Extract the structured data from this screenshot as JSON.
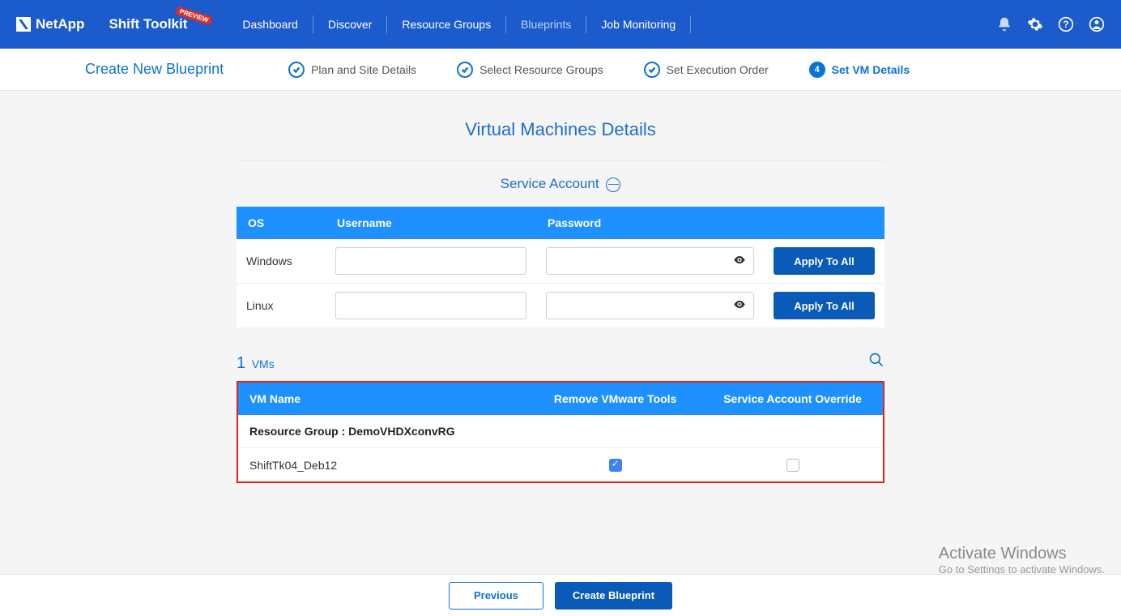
{
  "brand": {
    "company": "NetApp",
    "product": "Shift Toolkit",
    "badge": "PREVIEW"
  },
  "nav": {
    "items": [
      "Dashboard",
      "Discover",
      "Resource Groups",
      "Blueprints",
      "Job Monitoring"
    ],
    "active_index": 3
  },
  "page": {
    "title": "Create New Blueprint",
    "steps": [
      "Plan and Site Details",
      "Select Resource Groups",
      "Set Execution Order",
      "Set VM Details"
    ],
    "active_step": 3,
    "section_title": "Virtual Machines Details",
    "service_account_title": "Service Account",
    "collapse_glyph": "—"
  },
  "service_account": {
    "headers": {
      "os": "OS",
      "username": "Username",
      "password": "Password"
    },
    "rows": [
      {
        "os": "Windows",
        "username": "",
        "password": "",
        "apply_label": "Apply To All"
      },
      {
        "os": "Linux",
        "username": "",
        "password": "",
        "apply_label": "Apply To All"
      }
    ]
  },
  "vms": {
    "count": "1",
    "count_label": "VMs",
    "headers": {
      "name": "VM Name",
      "remove": "Remove VMware Tools",
      "override": "Service Account Override"
    },
    "group_prefix": "Resource Group : ",
    "group_name": "DemoVHDXconvRG",
    "rows": [
      {
        "name": "ShiftTk04_Deb12",
        "remove_checked": true,
        "override_checked": false
      }
    ]
  },
  "footer": {
    "previous": "Previous",
    "create": "Create Blueprint"
  },
  "watermark": {
    "line1": "Activate Windows",
    "line2": "Go to Settings to activate Windows."
  }
}
